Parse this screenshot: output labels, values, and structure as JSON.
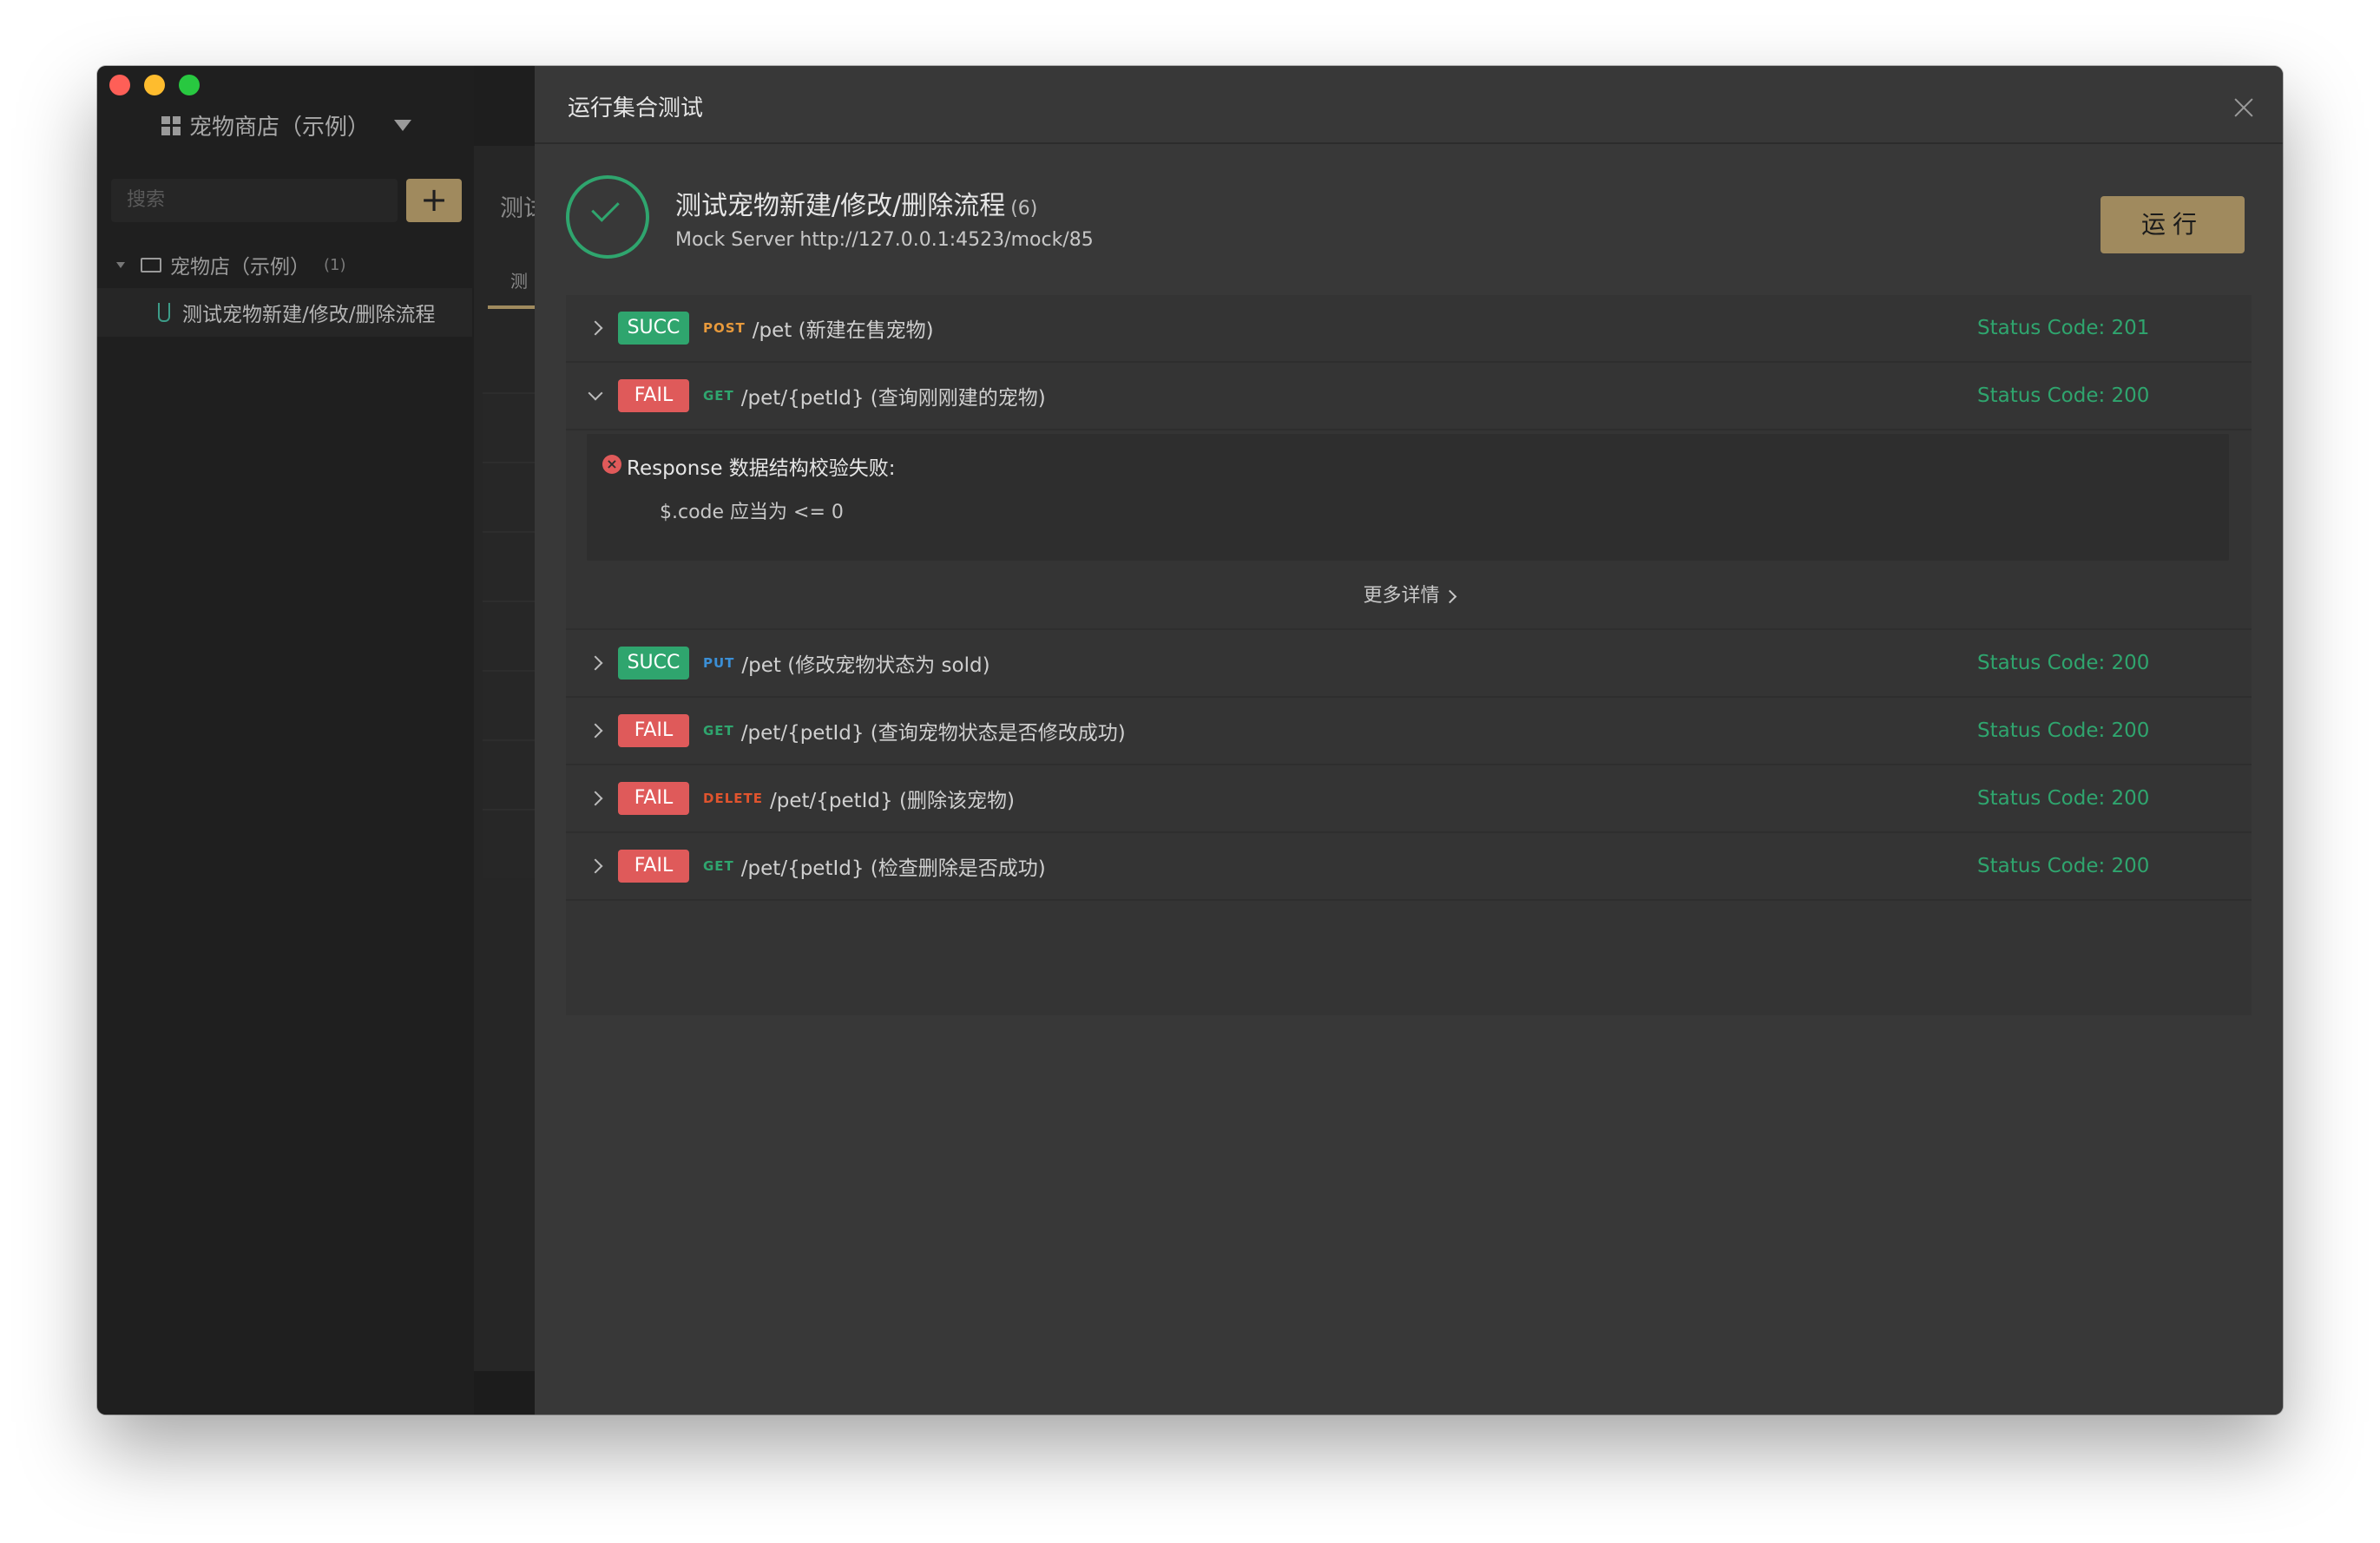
{
  "sidebar": {
    "project_title": "宠物商店（示例）",
    "search_placeholder": "搜索",
    "add_label": "+",
    "folder": {
      "label": "宠物店（示例）",
      "count": "(1)"
    },
    "item": {
      "label": "测试宠物新建/修改/删除流程"
    }
  },
  "middle": {
    "title": "测试",
    "tab": "测"
  },
  "modal": {
    "title": "运行集合测试",
    "suite_name": "测试宠物新建/修改/删除流程",
    "suite_count": "(6)",
    "mock_server": "Mock Server http://127.0.0.1:4523/mock/85",
    "run_label": "运行",
    "more_label": "更多详情",
    "error": {
      "title": "Response 数据结构校验失败:",
      "message": "$.code 应当为 <= 0"
    },
    "results": [
      {
        "status": "SUCC",
        "method": "POST",
        "endpoint": "/pet (新建在售宠物)",
        "code": "Status Code: 201"
      },
      {
        "status": "FAIL",
        "method": "GET",
        "endpoint": "/pet/{petId} (查询刚刚建的宠物)",
        "code": "Status Code: 200"
      },
      {
        "status": "SUCC",
        "method": "PUT",
        "endpoint": "/pet (修改宠物状态为 sold)",
        "code": "Status Code: 200"
      },
      {
        "status": "FAIL",
        "method": "GET",
        "endpoint": "/pet/{petId} (查询宠物状态是否修改成功)",
        "code": "Status Code: 200"
      },
      {
        "status": "FAIL",
        "method": "DELETE",
        "endpoint": "/pet/{petId} (删除该宠物)",
        "code": "Status Code: 200"
      },
      {
        "status": "FAIL",
        "method": "GET",
        "endpoint": "/pet/{petId} (检查删除是否成功)",
        "code": "Status Code: 200"
      }
    ]
  },
  "colors": {
    "success": "#2fa56e",
    "fail": "#df5a5a",
    "accent": "#a08a5e"
  }
}
